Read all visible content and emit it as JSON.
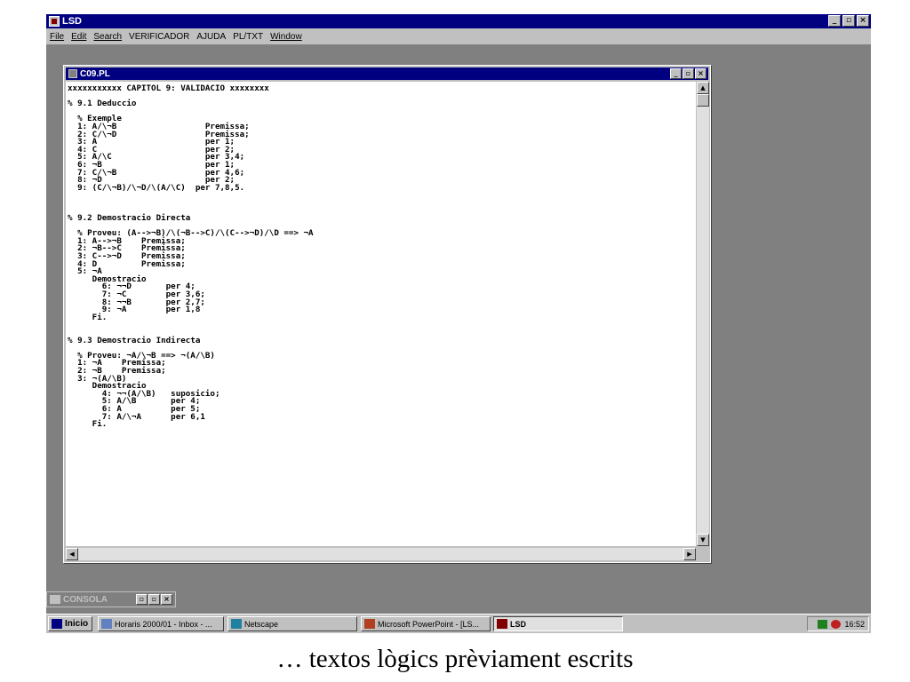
{
  "app": {
    "title": "LSD",
    "window_buttons": [
      "_",
      "▫",
      "×"
    ]
  },
  "menu": {
    "items": [
      "File",
      "Edit",
      "Search",
      "VERIFICADOR",
      "AJUDA",
      "PL/TXT",
      "Window"
    ]
  },
  "document": {
    "title": "C09.PL",
    "lines": [
      "xxxxxxxxxxx CAPITOL 9: VALIDACIO xxxxxxxx",
      "",
      "% 9.1 Deduccio",
      "",
      "  % Exemple",
      "  1: A/\\¬B                  Premissa;",
      "  2: C/\\¬D                  Premissa;",
      "  3: A                      per 1;",
      "  4: C                      per 2;",
      "  5: A/\\C                   per 3,4;",
      "  6: ¬B                     per 1;",
      "  7: C/\\¬B                  per 4,6;",
      "  8: ¬D                     per 2;",
      "  9: (C/\\¬B)/\\¬D/\\(A/\\C)  per 7,8,5.",
      "",
      "",
      "",
      "% 9.2 Demostracio Directa",
      "",
      "  % Proveu: (A-->¬B)/\\(¬B-->C)/\\(C-->¬D)/\\D ==> ¬A",
      "  1: A-->¬B    Premissa;",
      "  2: ¬B-->C    Premissa;",
      "  3: C-->¬D    Premissa;",
      "  4: D         Premissa;",
      "  5: ¬A",
      "     Demostracio",
      "       6: ¬¬D       per 4;",
      "       7: ¬C        per 3,6;",
      "       8: ¬¬B       per 2,7;",
      "       9: ¬A        per 1,8",
      "     Fi.",
      "",
      "",
      "% 9.3 Demostracio Indirecta",
      "",
      "  % Proveu: ¬A/\\¬B ==> ¬(A/\\B)",
      "  1: ¬A    Premissa;",
      "  2: ¬B    Premissa;",
      "  3: ¬(A/\\B)",
      "     Demostracio",
      "       4: ¬¬(A/\\B)   suposicio;",
      "       5: A/\\B       per 4;",
      "       6: A          per 5;",
      "       7: A/\\¬A      per 6,1",
      "     Fi."
    ]
  },
  "console": {
    "title": "CONSOLA"
  },
  "taskbar": {
    "start_label": "Inicio",
    "tasks": [
      {
        "label": "Horaris 2000/01 - Inbox - ...",
        "icon": "envelope-icon"
      },
      {
        "label": "Netscape",
        "icon": "netscape-icon"
      },
      {
        "label": "Microsoft PowerPoint - [LS...",
        "icon": "powerpoint-icon"
      },
      {
        "label": "LSD",
        "icon": "lsd-app-icon"
      }
    ],
    "clock": "16:52"
  },
  "caption": "… textos lògics prèviament escrits",
  "colors": {
    "titlebar": "#000080",
    "chrome": "#c0c0c0",
    "desktop": "#808080"
  }
}
